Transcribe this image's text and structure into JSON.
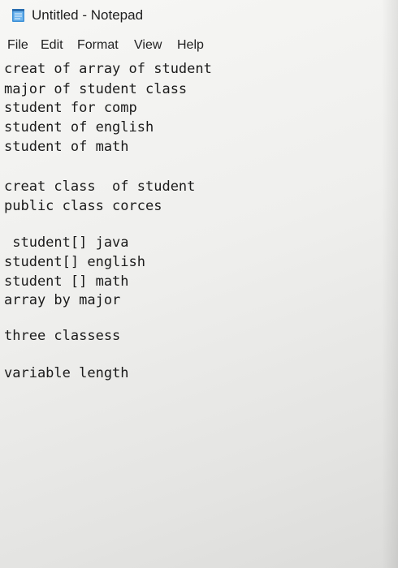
{
  "window": {
    "title": "Untitled - Notepad",
    "icon": "notepad-icon"
  },
  "menu": [
    {
      "label": "File"
    },
    {
      "label": "Edit"
    },
    {
      "label": "Format"
    },
    {
      "label": "View"
    },
    {
      "label": "Help"
    }
  ],
  "editor": {
    "lines": [
      "creat of array of student",
      "major of student class",
      "student for comp",
      "student of english",
      "student of math",
      "creat class  of student",
      "public class corces",
      " student[] java",
      "student[] english",
      "student [] math",
      "array by major",
      "three classess",
      "variable length"
    ]
  }
}
